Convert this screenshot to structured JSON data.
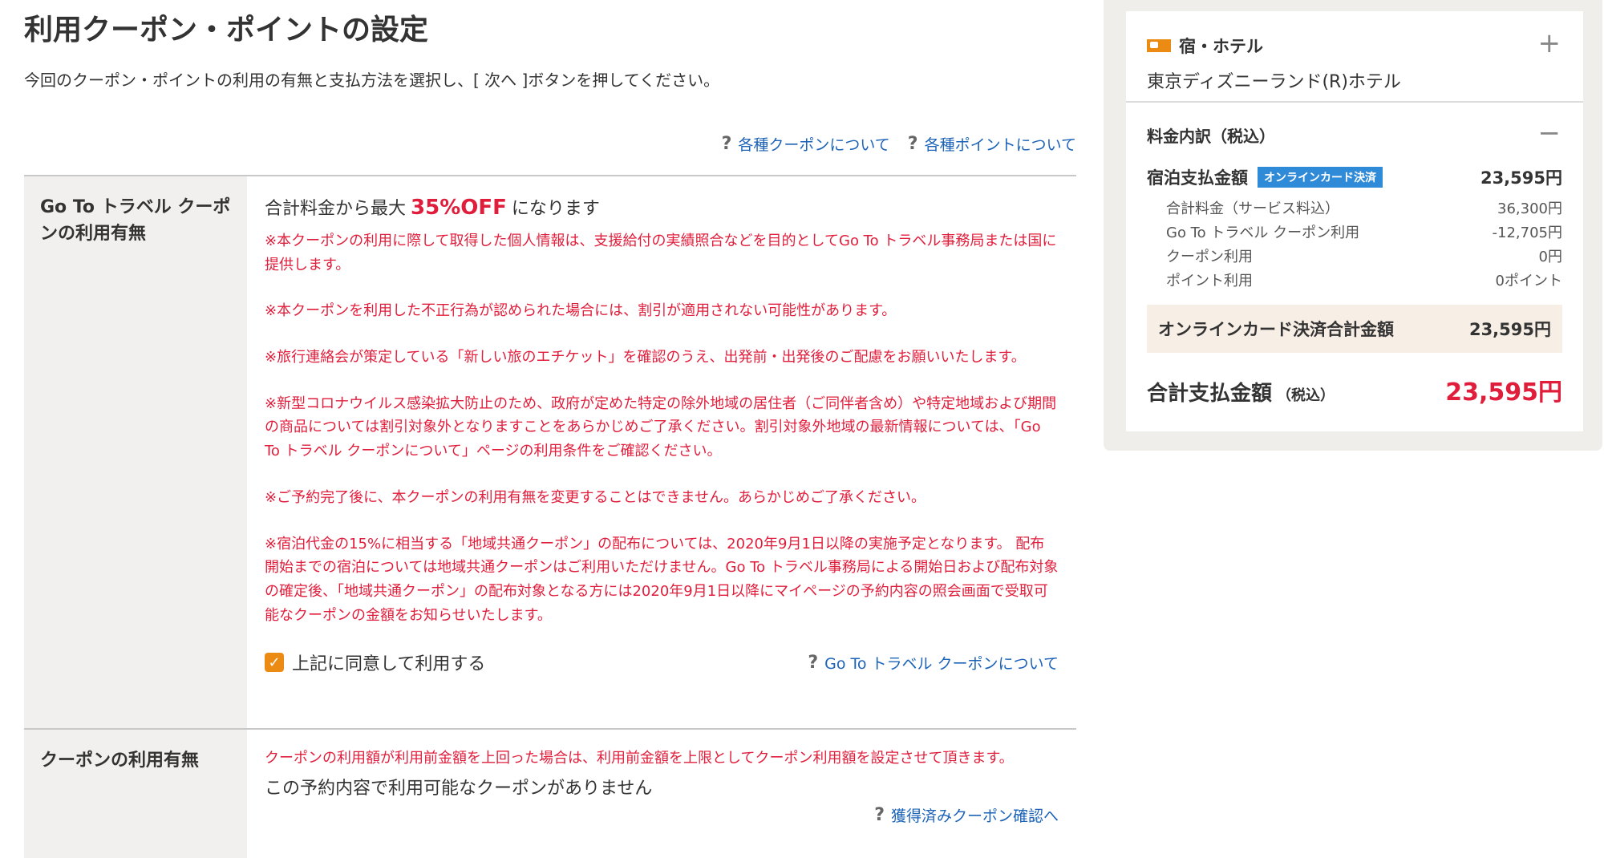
{
  "page": {
    "title": "利用クーポン・ポイントの設定",
    "intro": "今回のクーポン・ポイントの利用の有無と支払方法を選択し、[ 次へ ]ボタンを押してください。",
    "help_links": [
      "各種クーポンについて",
      "各種ポイントについて"
    ]
  },
  "goto_section": {
    "label": "Go To トラベル クーポンの利用有無",
    "headline_pre": "合計料金から最大",
    "headline_pct": "35%OFF",
    "headline_post": "になります",
    "notes": [
      "※本クーポンの利用に際して取得した個人情報は、支援給付の実績照合などを目的としてGo To トラベル事務局または国に提供します。",
      "※本クーポンを利用した不正行為が認められた場合には、割引が適用されない可能性があります。",
      "※旅行連絡会が策定している「新しい旅のエチケット」を確認のうえ、出発前・出発後のご配慮をお願いいたします。",
      "※新型コロナウイルス感染拡大防止のため、政府が定めた特定の除外地域の居住者（ご同伴者含め）や特定地域および期間の商品については割引対象外となりますことをあらかじめご了承ください。割引対象外地域の最新情報については、「Go To トラベル クーポンについて」ページの利用条件をご確認ください。",
      "※ご予約完了後に、本クーポンの利用有無を変更することはできません。あらかじめご了承ください。",
      "※宿泊代金の15%に相当する「地域共通クーポン」の配布については、2020年9月1日以降の実施予定となります。 配布開始までの宿泊については地域共通クーポンはご利用いただけません。Go To トラベル事務局による開始日および配布対象の確定後、「地域共通クーポン」の配布対象となる方には2020年9月1日以降にマイページの予約内容の照会画面で受取可能なクーポンの金額をお知らせいたします。"
    ],
    "agree_label": "上記に同意して利用する",
    "agree_checked": true,
    "link": "Go To トラベル クーポンについて"
  },
  "coupon_section": {
    "label": "クーポンの利用有無",
    "note": "クーポンの利用額が利用前金額を上回った場合は、利用前金額を上限としてクーポン利用額を設定させて頂きます。",
    "none_text": "この予約内容で利用可能なクーポンがありません",
    "link": "獲得済みクーポン確認へ"
  },
  "sidebar": {
    "category": "宿・ホテル",
    "hotel_name": "東京ディズニーランド(R)ホテル",
    "breakdown_title": "料金内訳（税込）",
    "stay_label": "宿泊支払金額",
    "stay_badge": "オンラインカード決済",
    "stay_amount": "23,595円",
    "details": [
      {
        "label": "合計料金（サービス料込）",
        "value": "36,300円"
      },
      {
        "label": "Go To トラベル クーポン利用",
        "value": "-12,705円"
      },
      {
        "label": "クーポン利用",
        "value": "0円"
      },
      {
        "label": "ポイント利用",
        "value": "0ポイント"
      }
    ],
    "card_total_label": "オンラインカード決済合計金額",
    "card_total_amount": "23,595円",
    "grand_label": "合計支払金額",
    "grand_sub": "（税込）",
    "grand_amount": "23,595円"
  },
  "colors": {
    "accent_red": "#e01e3c",
    "link_blue": "#1c63b8",
    "orange": "#ec8b14",
    "badge_blue": "#2f8ad8"
  }
}
